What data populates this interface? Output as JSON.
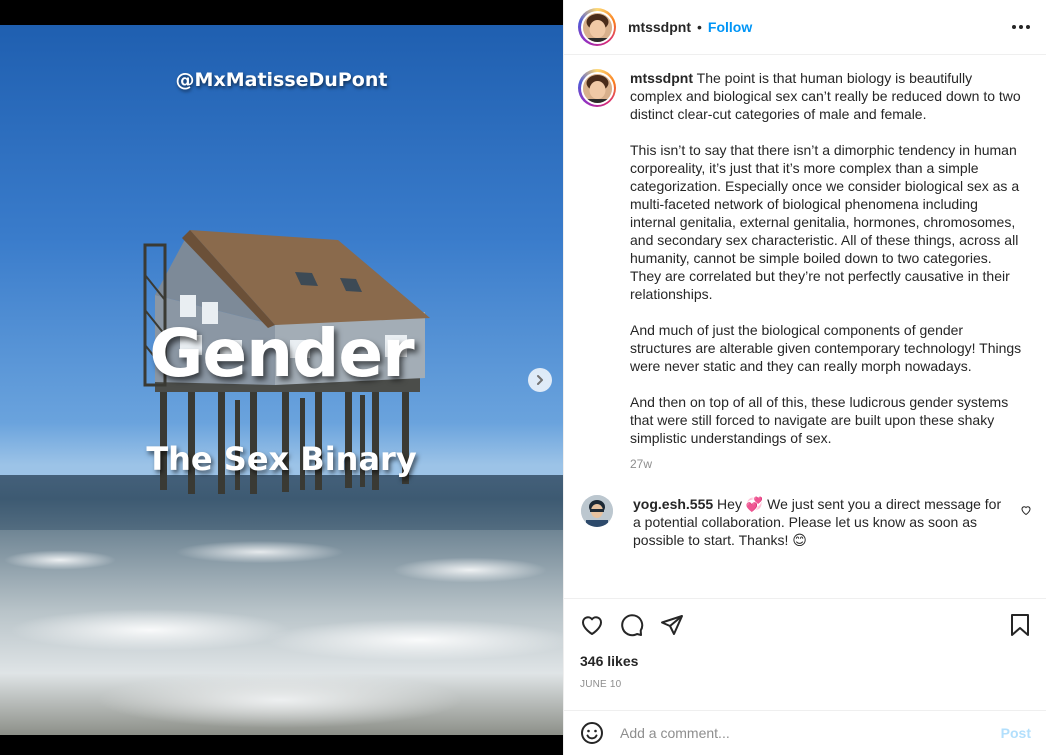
{
  "post_image": {
    "handle": "@MxMatisseDuPont",
    "title": "Gender",
    "subtitle": "The Sex Binary",
    "carousel": {
      "total": 2,
      "current": 1
    }
  },
  "header": {
    "username": "mtssdpnt",
    "separator": "•",
    "follow_label": "Follow"
  },
  "caption": {
    "username": "mtssdpnt",
    "paragraphs": [
      "The point is that human biology is beautifully complex and biological sex can’t really be reduced down to two distinct clear-cut categories of male and female.",
      "This isn’t to say that there isn’t a dimorphic tendency in human corporeality, it’s just that it’s more complex than a simple categorization. Especially once we consider biological sex as a multi-faceted network of biological phenomena including internal genitalia, external genitalia, hormones, chromosomes, and secondary sex characteristic. All of these things, across all humanity, cannot be simple boiled down to two categories. They are correlated but they’re not perfectly causative in their relationships.",
      "And much of just the biological components of gender structures are alterable given contemporary technology! Things were never static and they can really morph nowadays.",
      "And then on top of all of this, these ludicrous gender systems that were still forced to navigate are built upon these shaky simplistic understandings of sex."
    ],
    "time": "27w"
  },
  "comment": {
    "username": "yog.esh.555",
    "text": "Hey 💞 We just sent you a direct message for a potential collaboration. Please let us know as soon as possible to start. Thanks! 😊"
  },
  "actions": {
    "likes": "346 likes",
    "date": "JUNE 10"
  },
  "add_comment": {
    "placeholder": "Add a comment...",
    "post_label": "Post"
  },
  "colors": {
    "follow": "#0095f6",
    "post_disabled": "#b2dffc",
    "muted": "#8e8e8e"
  },
  "icons": [
    "chevron-right-icon",
    "more-icon",
    "heart-icon",
    "comment-icon",
    "share-icon",
    "bookmark-icon",
    "emoji-icon"
  ]
}
